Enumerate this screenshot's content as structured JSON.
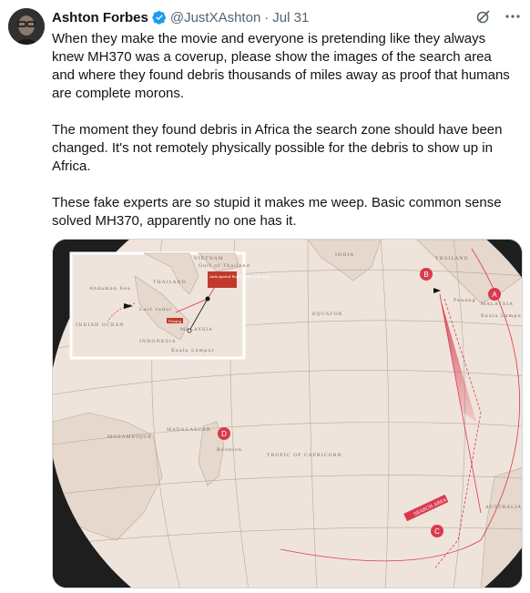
{
  "author": {
    "name": "Ashton Forbes",
    "handle": "@JustXAshton",
    "date": "Jul 31",
    "avatar_icon": "avatar-photo",
    "verified_color": "#1d9bf0"
  },
  "tweet": {
    "paragraphs": [
      "When they make the movie and everyone is pretending like they always knew MH370 was a coverup, please show the images of the search area and where they found debris thousands of miles away as proof that humans are complete morons.",
      "The moment they found debris in Africa the search zone should have been changed. It's not remotely physically possible for the debris to show up in Africa.",
      "These fake experts are so stupid it makes me weep. Basic common sense solved MH370, apparently no one has it."
    ]
  },
  "icons": {
    "grok": "grok-icon",
    "more": "more-icon"
  },
  "map": {
    "labels": {
      "india": "INDIA",
      "thailand": "THAILAND",
      "malaysia": "MALAYSIA",
      "kuala_lumpur": "Kuala Lumpur",
      "penang": "Penang",
      "equator": "EQUATOR",
      "madagascar": "MADAGASCAR",
      "mozambique": "MOZAMBIQUE",
      "reunion": "Réunion",
      "tropic": "TROPIC OF CAPRICORN",
      "australia": "AUSTRALIA",
      "search_area": "SEARCH AREA",
      "vietnam": "VIETNAM",
      "gulf": "Gulf of Thailand",
      "anticipated": "Anticipated flight path to Beijing",
      "indonesia": "INDONESIA",
      "andaman": "Andaman Sea",
      "indian_ocean": "INDIAN OCEAN",
      "last_radar": "Last radar"
    },
    "markers": [
      "A",
      "B",
      "C",
      "D"
    ],
    "accent": "#d93a4e",
    "ocean": "#efe4dc"
  }
}
